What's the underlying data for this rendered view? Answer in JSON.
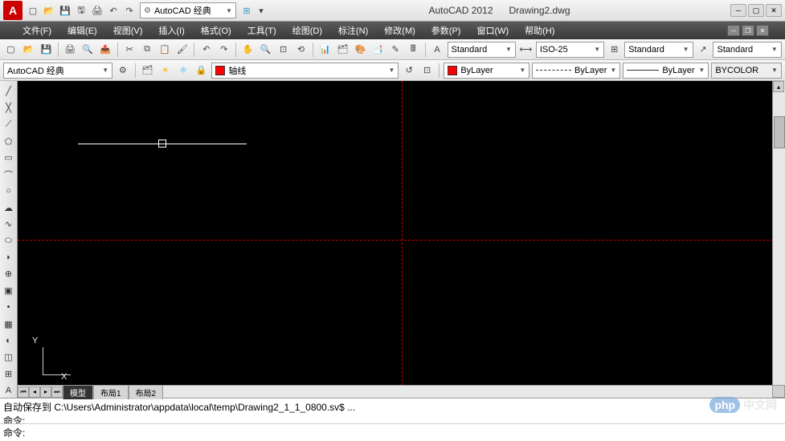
{
  "title": {
    "app": "AutoCAD 2012",
    "doc": "Drawing2.dwg",
    "icon_letter": "A"
  },
  "qat": [
    "new",
    "open",
    "save",
    "saveas",
    "plot",
    "undo",
    "redo"
  ],
  "workspace": {
    "label": "AutoCAD 经典"
  },
  "menus": [
    "文件(F)",
    "编辑(E)",
    "视图(V)",
    "插入(I)",
    "格式(O)",
    "工具(T)",
    "绘图(D)",
    "标注(N)",
    "修改(M)",
    "参数(P)",
    "窗口(W)",
    "帮助(H)"
  ],
  "toolbar1": {
    "style1": "Standard",
    "dimstyle": "ISO-25",
    "style2": "Standard",
    "style3": "Standard"
  },
  "toolbar2": {
    "workspace": "AutoCAD 经典",
    "layer_label": "轴线",
    "bylayer": "ByLayer",
    "linetype": "ByLayer",
    "lineweight": "ByLayer",
    "plotstyle": "BYCOLOR"
  },
  "draw_tools": [
    "line",
    "cline",
    "pline",
    "polygon",
    "rect",
    "arc",
    "circle",
    "revcloud",
    "spline",
    "ellipse",
    "ellipse-arc",
    "insert",
    "block",
    "point",
    "hatch",
    "gradient",
    "region",
    "table",
    "text"
  ],
  "tabs": {
    "items": [
      "模型",
      "布局1",
      "布局2"
    ],
    "active": 0
  },
  "command": {
    "history1": "自动保存到 C:\\Users\\Administrator\\appdata\\local\\temp\\Drawing2_1_1_0800.sv$ ...",
    "history2": "命令:",
    "prompt": "命令:"
  },
  "ucs": {
    "x": "X",
    "y": "Y"
  },
  "watermark": {
    "brand": "php",
    "text": "中文网"
  }
}
